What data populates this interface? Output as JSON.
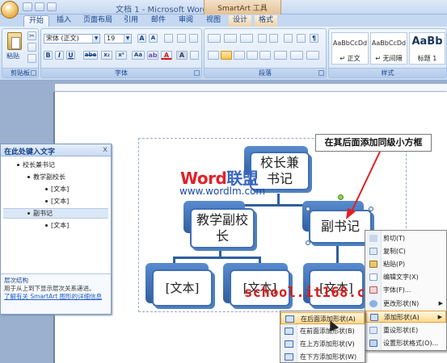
{
  "window": {
    "title": "文档 1 - Microsoft Word",
    "contextual_tab_group": "SmartArt 工具"
  },
  "tabs": [
    "开始",
    "插入",
    "页面布局",
    "引用",
    "邮件",
    "审阅",
    "视图",
    "设计",
    "格式"
  ],
  "ribbon": {
    "clipboard": {
      "paste_label": "粘贴",
      "group_label": "剪贴板"
    },
    "font": {
      "group_label": "字体",
      "font_name": "宋体 (正文)",
      "font_size": "19",
      "grow_label": "A",
      "shrink_label": "A",
      "format_buttons": [
        "B",
        "I",
        "U",
        "abe",
        "x₂",
        "x²",
        "Aa",
        "A",
        "A"
      ]
    },
    "paragraph": {
      "group_label": "段落"
    },
    "styles": {
      "group_label": "样式",
      "items": [
        {
          "sample": "AaBbCcDd",
          "name": "↵ 正文"
        },
        {
          "sample": "AaBbCcDd",
          "name": "↵ 无间隔"
        },
        {
          "sample": "AaBb",
          "name": "标题 1"
        }
      ]
    }
  },
  "text_pane": {
    "header": "在此处键入文字",
    "close_label": "x",
    "items": [
      {
        "text": "校长兼书记",
        "level": 1
      },
      {
        "text": "教学副校长",
        "level": 2
      },
      {
        "text": "[文本]",
        "level": 3
      },
      {
        "text": "[文本]",
        "level": 3
      },
      {
        "text": "副书记",
        "level": 2
      },
      {
        "text": "[文本]",
        "level": 3
      }
    ],
    "footer": {
      "title": "层次结构",
      "description": "用于从上到下显示层次关系递进。",
      "link": "了解有关 SmartArt 图形的详细信息"
    }
  },
  "smartart": {
    "boxes": {
      "root": "校长兼书记",
      "child1": "教学副校长",
      "child2": "副书记",
      "leaf1": "[文本]",
      "leaf2": "[文本]",
      "leaf3": "[文本]"
    }
  },
  "watermarks": {
    "brand_red": "Word",
    "brand_blue": "联盟",
    "url": "www.wordlm.com",
    "school": "school.it168.com"
  },
  "callout": "在其后面添加同级小方框",
  "context_menu": {
    "items": [
      {
        "label": "剪切(T)",
        "icon": "cut-icon"
      },
      {
        "label": "复制(C)",
        "icon": "copy-icon"
      },
      {
        "label": "粘贴(P)",
        "icon": "paste-icon"
      },
      {
        "label": "编辑文字(X)",
        "icon": "edit-text-icon"
      },
      {
        "label": "字体(F)...",
        "icon": "font-icon"
      },
      {
        "label": "更改形状(N)",
        "icon": "change-shape-icon",
        "submenu": "▶"
      },
      {
        "label": "添加形状(A)",
        "icon": "add-shape-icon",
        "submenu": "▶"
      },
      {
        "label": "重设形状(E)",
        "icon": "reset-shape-icon"
      },
      {
        "label": "设置形状格式(O)...",
        "icon": "format-shape-icon"
      }
    ]
  },
  "submenu": {
    "items": [
      {
        "label": "在后面添加形状(A)"
      },
      {
        "label": "在前面添加形状(B)"
      },
      {
        "label": "在上方添加形状(V)"
      },
      {
        "label": "在下方添加形状(W)"
      }
    ]
  },
  "colors": {
    "accent_blue": "#15428b",
    "smartart_blue": "#3f6fb5",
    "menu_highlight": "#ffd98f",
    "watermark_red": "#e0222a"
  }
}
